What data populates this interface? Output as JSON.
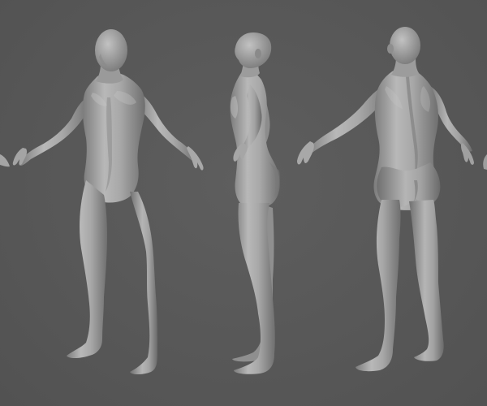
{
  "scene": {
    "background_color": "#585858",
    "model_color": "#a9a9a9",
    "model_shadow_color": "#6e6e6e",
    "model_highlight_color": "#c4c4c4",
    "views": [
      {
        "name": "three-quarter-front"
      },
      {
        "name": "side-profile"
      },
      {
        "name": "back"
      }
    ]
  }
}
